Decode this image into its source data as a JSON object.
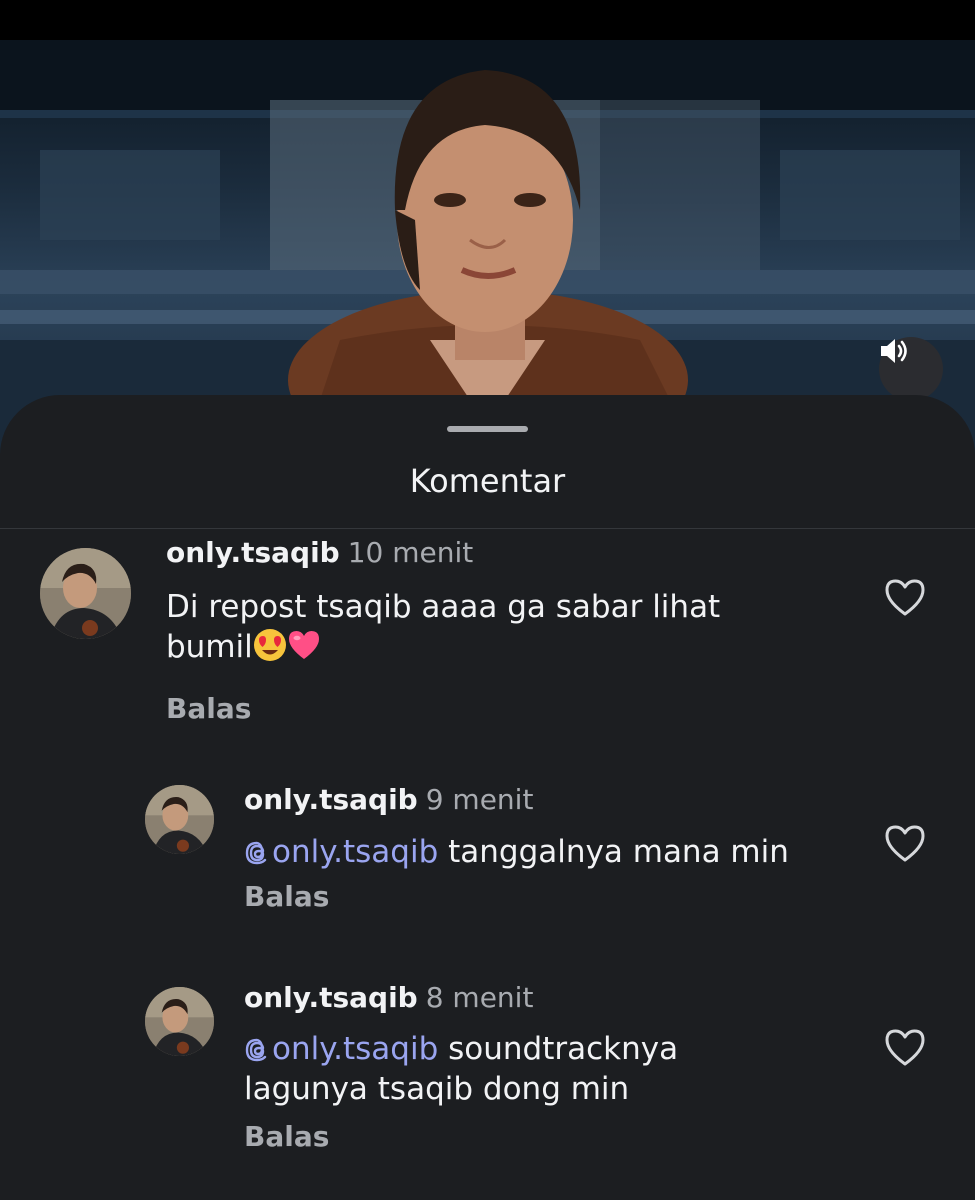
{
  "video": {
    "sound_icon": "volume-icon"
  },
  "sheet": {
    "title": "Komentar"
  },
  "comments": [
    {
      "username": "only.tsaqib",
      "time": "10 menit",
      "text_line1": "Di repost tsaqib aaaa ga sabar lihat",
      "text_line2": "bumil",
      "emojis": [
        "heart-eyes-emoji",
        "pink-heart-emoji"
      ],
      "reply_label": "Balas",
      "like_icon": "heart-outline-icon"
    },
    {
      "username": "only.tsaqib",
      "time": "9 menit",
      "mention": "only.tsaqib",
      "text_line1": " tanggalnya mana min",
      "reply_label": "Balas",
      "like_icon": "heart-outline-icon"
    },
    {
      "username": "only.tsaqib",
      "time": "8 menit",
      "mention": "only.tsaqib",
      "text_line1": " soundtracknya",
      "text_line2": "lagunya tsaqib dong min",
      "reply_label": "Balas",
      "like_icon": "heart-outline-icon"
    }
  ],
  "colors": {
    "sheet_background": "#1c1e21",
    "mention": "#9aa5f0",
    "secondary_text": "#a8abb0"
  }
}
